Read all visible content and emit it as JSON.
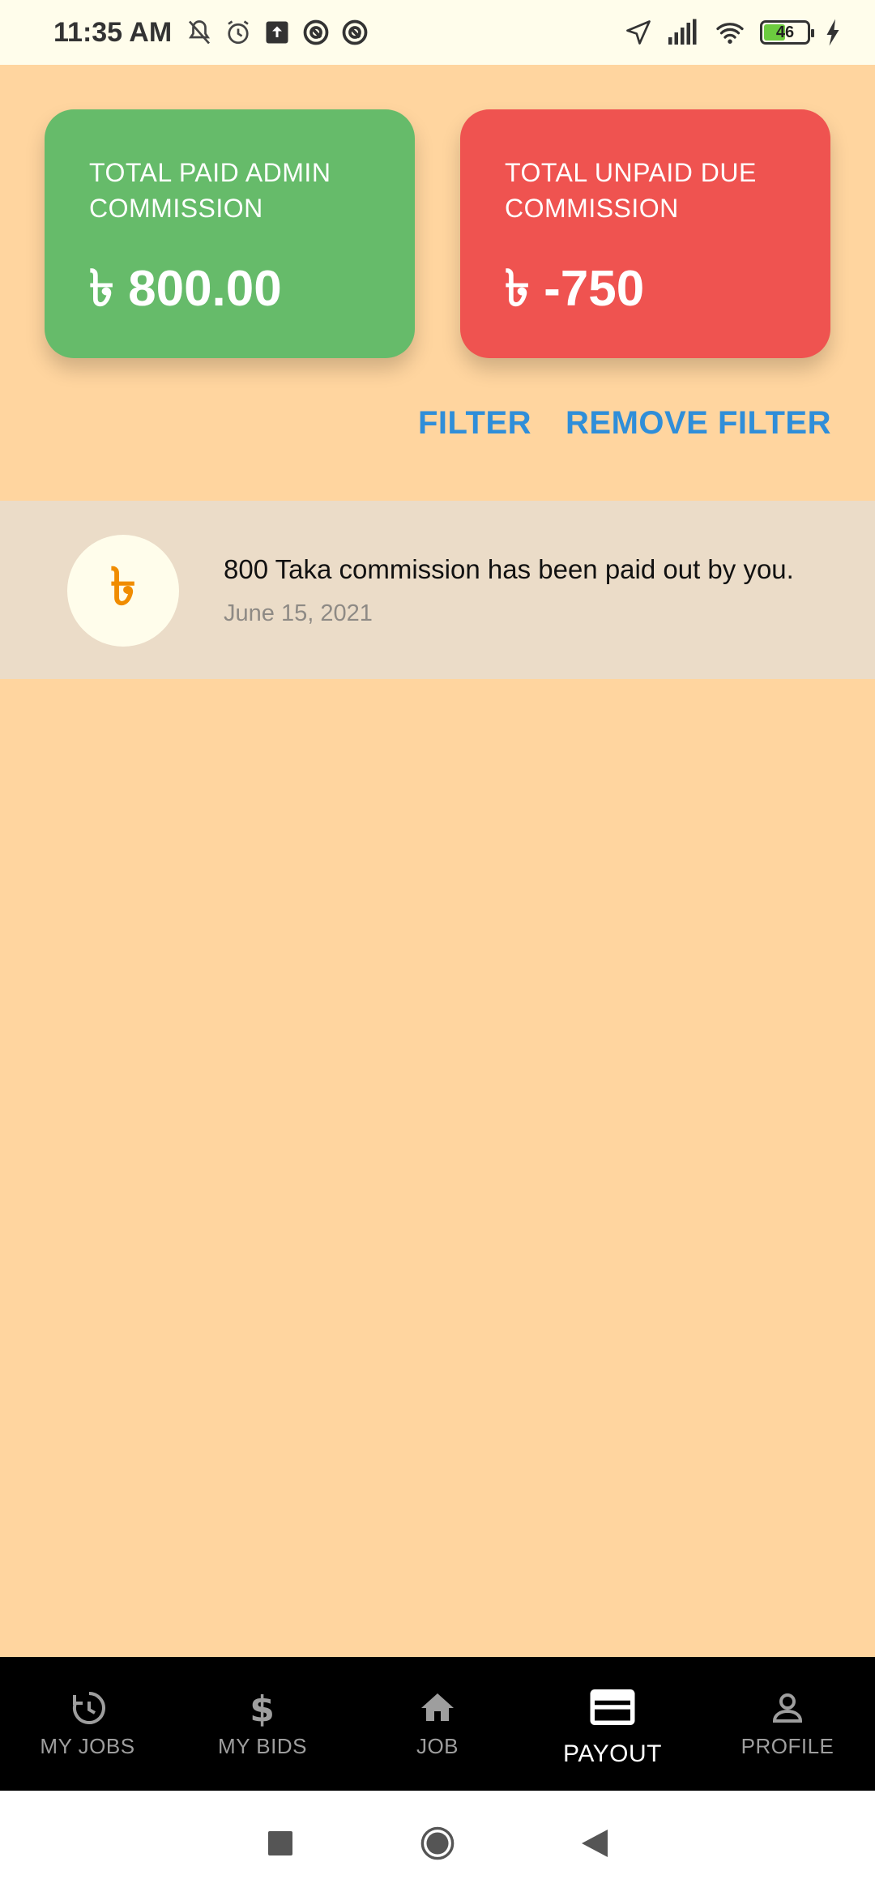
{
  "status_bar": {
    "time": "11:35 AM",
    "battery": "46",
    "left_icons": [
      "mute-icon",
      "alarm-icon",
      "upload-icon",
      "app-icon",
      "app-icon"
    ],
    "right_icons": [
      "location-icon",
      "signal-icon",
      "wifi-icon",
      "battery-icon",
      "charging-icon"
    ]
  },
  "summary": {
    "paid_label": "TOTAL PAID ADMIN COMMISSION",
    "paid_value": "৳ 800.00",
    "unpaid_label": "TOTAL UNPAID DUE COMMISSION",
    "unpaid_value": "৳ -750",
    "colors": {
      "paid": "#66BB6A",
      "unpaid": "#EF5350"
    }
  },
  "filters": {
    "filter_label": "FILTER",
    "remove_filter_label": "REMOVE FILTER"
  },
  "transactions": [
    {
      "icon_text": "৳",
      "title": "800 Taka commission has been paid out by you.",
      "date": "June 15, 2021"
    }
  ],
  "bottom_nav": [
    {
      "label": "MY JOBS",
      "icon": "history-icon",
      "active": false
    },
    {
      "label": "MY BIDS",
      "icon": "dollar-icon",
      "active": false
    },
    {
      "label": "JOB",
      "icon": "home-icon",
      "active": false
    },
    {
      "label": "PAYOUT",
      "icon": "card-icon",
      "active": true
    },
    {
      "label": "PROFILE",
      "icon": "person-icon",
      "active": false
    }
  ],
  "system_nav": [
    "recents-button",
    "home-button",
    "back-button"
  ]
}
